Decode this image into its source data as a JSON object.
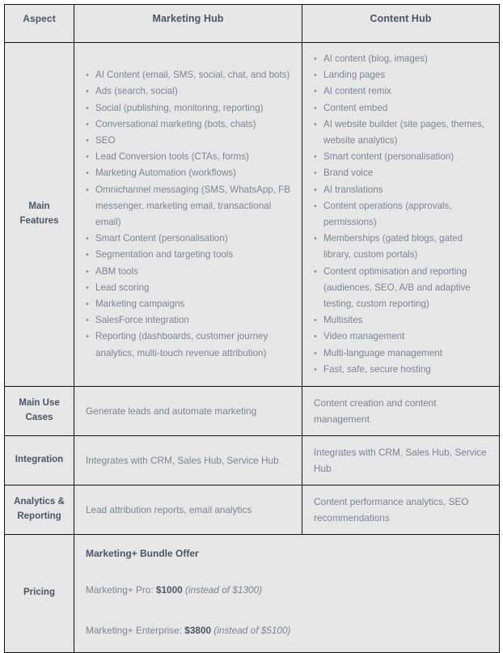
{
  "table": {
    "columns": [
      "Aspect",
      "Marketing Hub",
      "Content Hub"
    ],
    "rows": {
      "main_features": {
        "label_line1": "Main",
        "label_line2": "Features",
        "marketing_hub": [
          "AI Content (email, SMS, social, chat, and bots)",
          "Ads (search, social)",
          "Social (publishing, monitoring, reporting)",
          "Conversational marketing (bots, chats)",
          "SEO",
          "Lead Conversion tools (CTAs, forms)",
          "Marketing Automation (workflows)",
          "Omnichannel messaging (SMS, WhatsApp, FB messenger, marketing email, transactional email)",
          "Smart Content (personalisation)",
          "Segmentation and targeting tools",
          "ABM tools",
          "Lead scoring",
          "Marketing campaigns",
          "SalesForce integration",
          "Reporting (dashboards, customer journey analytics, multi-touch revenue attribution)"
        ],
        "content_hub": [
          "AI content (blog, images)",
          "Landing pages",
          "AI content remix",
          "Content embed",
          "AI website builder (site pages, themes, website analytics)",
          "Smart content (personalisation)",
          "Brand voice",
          "AI translations",
          "Content operations (approvals, permissions)",
          "Memberships (gated blogs, gated library, custom portals)",
          "Content optimisation and reporting (audiences, SEO, A/B and adaptive testing, custom reporting)",
          "Multisites",
          "Video management",
          "Multi-language management",
          "Fast, safe, secure hosting"
        ]
      },
      "main_use_cases": {
        "label_line1": "Main Use",
        "label_line2": "Cases",
        "marketing_hub": "Generate leads and automate marketing",
        "content_hub": "Content creation and content management"
      },
      "integration": {
        "label_line1": "Integration",
        "label_line2": "",
        "marketing_hub": "Integrates with CRM, Sales Hub, Service Hub",
        "content_hub": "Integrates with CRM, Sales Hub, Service Hub"
      },
      "analytics_reporting": {
        "label_line1": "Analytics &",
        "label_line2": "Reporting",
        "marketing_hub": "Lead attribution reports, email analytics",
        "content_hub": "Content performance analytics, SEO recommendations"
      },
      "pricing": {
        "label_line1": "Pricing",
        "label_line2": "",
        "bundle_title": "Marketing+ Bundle Offer",
        "pro_label": "Marketing+ Pro: ",
        "pro_price": "$1000",
        "pro_was": " (instead of $1300)",
        "enterprise_label": "Marketing+ Enterprise: ",
        "enterprise_price": "$3800",
        "enterprise_was": " (instead of $5100)"
      }
    }
  },
  "colors": {
    "cell_background": "#e6e6e6",
    "page_background": "#ffffff",
    "border": "#111111",
    "heading_text": "#4a5668",
    "body_text": "#7b8494"
  }
}
